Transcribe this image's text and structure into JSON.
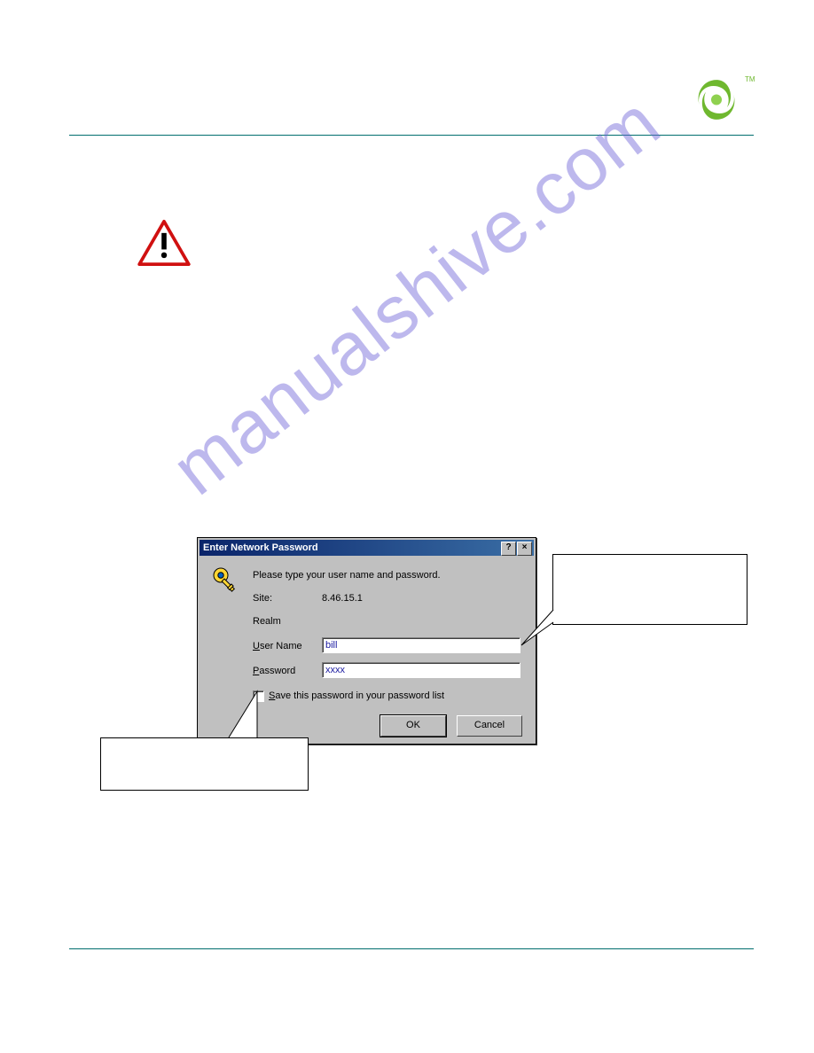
{
  "logo": {
    "tm": "TM"
  },
  "dialog": {
    "title": "Enter Network Password",
    "help": "?",
    "close": "×",
    "prompt": "Please type your user name and password.",
    "site_label": "Site:",
    "site_value": "8.46.15.1",
    "realm_label": "Realm",
    "username_label_pre": "U",
    "username_label_rest": "ser Name",
    "username_value": "bill",
    "password_label_pre": "P",
    "password_label_rest": "assword",
    "password_value": "xxxx",
    "save_label_pre": "S",
    "save_label_rest": "ave this password in your password list",
    "ok": "OK",
    "cancel": "Cancel"
  },
  "watermark": "manualshive.com"
}
